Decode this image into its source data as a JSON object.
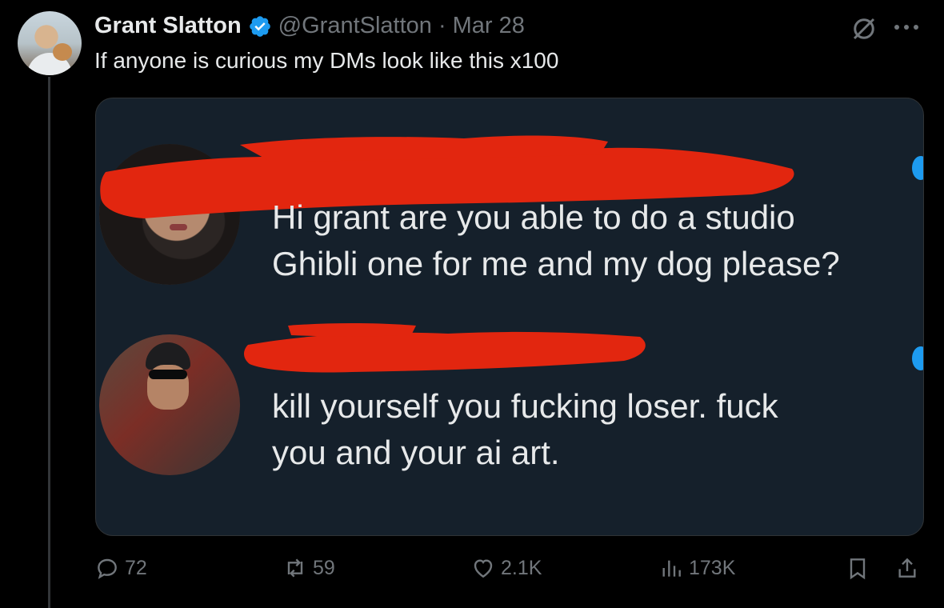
{
  "author": {
    "name": "Grant Slatton",
    "handle": "@GrantSlatton",
    "separator": "·",
    "date": "Mar 28",
    "verified": true
  },
  "tweet": {
    "text": "If anyone is curious my DMs look like this x100"
  },
  "media": {
    "messages": [
      {
        "text": "Hi grant are you able to do a studio\nGhibli one for me and my dog please?",
        "sender_redacted": true,
        "unread": true
      },
      {
        "text": "kill yourself you fucking loser. fuck\nyou and your ai art.",
        "sender_redacted": true,
        "unread": true
      }
    ],
    "redaction_color": "#e2260f",
    "unread_color": "#1d9bf0"
  },
  "metrics": {
    "replies": "72",
    "reposts": "59",
    "likes": "2.1K",
    "views": "173K"
  },
  "icons": {
    "verified": "verified-badge-icon",
    "grok": "grok-icon",
    "more": "more-icon",
    "reply": "reply-icon",
    "repost": "repost-icon",
    "like": "heart-icon",
    "views": "views-icon",
    "bookmark": "bookmark-icon",
    "share": "share-icon"
  }
}
